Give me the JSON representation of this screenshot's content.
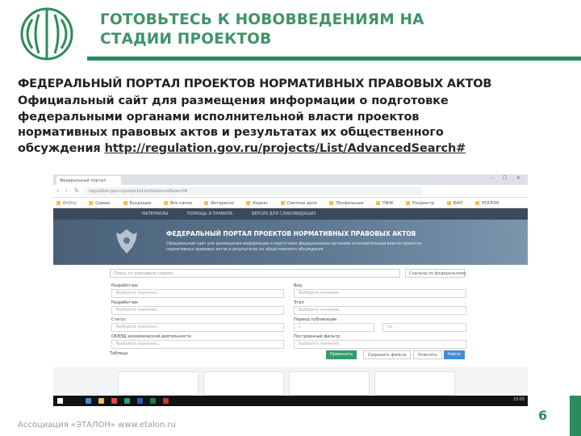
{
  "colors": {
    "brand_green": "#2a8c5c",
    "title_green": "#3f9468"
  },
  "slide": {
    "title_line1": "ГОТОВЬТЕСЬ К НОВОВВЕДЕНИЯМ НА",
    "title_line2": "СТАДИИ ПРОЕКТОВ",
    "heading": "ФЕДЕРАЛЬНЫЙ ПОРТАЛ ПРОЕКТОВ НОРМАТИВНЫХ ПРАВОВЫХ АКТОВ",
    "desc_line1": "Официальный сайт для размещения информации о подготовке",
    "desc_line2": "федеральными органами исполнительной власти проектов",
    "desc_line3": "нормативных правовых актов и результатах их общественного",
    "desc_line4": "обсуждения",
    "link": "http://regulation.gov.ru/projects/List/AdvancedSearch#",
    "footer": "Ассоциация «ЭТАЛОН» www.etalon.ru",
    "page_number": "6"
  },
  "screenshot": {
    "tab_title": "Федеральный портал",
    "address": "regulation.gov.ru/projects/List/AdvancedSearch#",
    "bookmarks": [
      "ОтОту",
      "Сервис",
      "Входящие",
      "Все папки",
      "Интересно",
      "Кодекс",
      "Сметное дело",
      "Профильные",
      "ПФЖ",
      "Росреестр",
      "ФАП",
      "ЭТАЛОН"
    ],
    "site_nav": [
      "МАТЕРИАЛЫ",
      "ПОМОЩЬ И ПРАВИЛА",
      "ВЕРСИЯ ДЛЯ СЛАБОВИДЯЩИХ"
    ],
    "portal_title": "ФЕДЕРАЛЬНЫЙ ПОРТАЛ ПРОЕКТОВ НОРМАТИВНЫХ ПРАВОВЫХ АКТОВ",
    "portal_desc": "Официальный сайт для размещения информации о подготовке федеральными органами исполнительной власти проектов нормативных правовых актов и результатах их общественного обсуждения",
    "search_placeholder": "Поиск по ключевым словам",
    "sort_label": "Сначала по федеральному",
    "fields": {
      "dept_label": "Разработчик",
      "dept_placeholder": "Выберите значение...",
      "type_label": "Вид",
      "type_placeholder": "Выберите значение...",
      "developer_label": "Разработчик",
      "developer_placeholder": "Выберите значение...",
      "stage_label": "Этап",
      "stage_placeholder": "Выберите значение...",
      "status_label": "Статус",
      "status_placeholder": "Выберите значение...",
      "period_label": "Период публикации",
      "period_from": "с",
      "period_to": "по",
      "okved_label": "ОКВЭД экономической деятельности",
      "okved_placeholder": "Выберите значение...",
      "filter_label": "Построенный фильтр",
      "filter_placeholder": "Выберите значение..."
    },
    "buttons": {
      "filter_tab": "Таблица",
      "apply": "Применить",
      "save_filter": "Сохранить фильтр",
      "reset": "Очистить",
      "find": "Найти"
    },
    "tray_time": "15:05"
  }
}
